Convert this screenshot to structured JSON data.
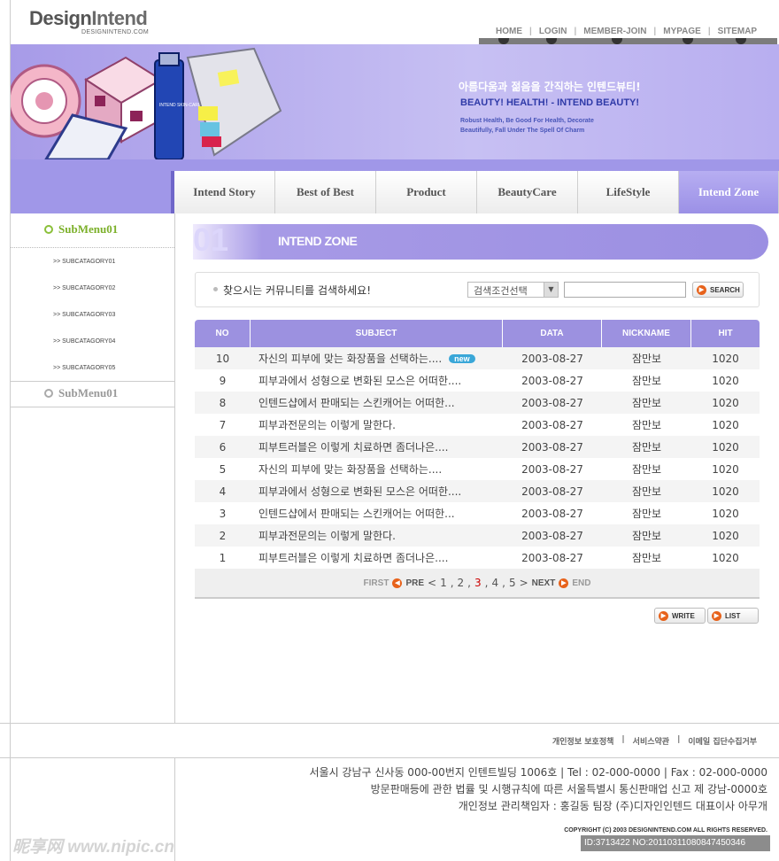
{
  "header": {
    "logo_main_a": "Design",
    "logo_main_b": "Intend",
    "logo_sub": "DESIGNINTEND.COM",
    "topnav": [
      "HOME",
      "LOGIN",
      "MEMBER-JOIN",
      "MYPAGE",
      "SITEMAP"
    ]
  },
  "banner": {
    "slogan_ko": "아름다움과 젊음을 간직하는 인텐드뷰티!",
    "slogan_en": "BEAUTY!  HEALTH! - INTEND BEAUTY!",
    "tagline_1": "Robust Health, Be Good For  Health, Decorate",
    "tagline_2": "Beautifully, Fall Under The Spell Of  Charm",
    "product_label": "INTEND SKIN-CARE"
  },
  "mainnav": [
    "Intend Story",
    "Best of Best",
    "Product",
    "BeautyCare",
    "LifeStyle",
    "Intend Zone"
  ],
  "sidebar": {
    "submenu_1": "SubMenu01",
    "submenu_2": "SubMenu01",
    "subcats": [
      ">> SUBCATAGORY01",
      ">> SUBCATAGORY02",
      ">> SUBCATAGORY03",
      ">> SUBCATAGORY04",
      ">> SUBCATAGORY05"
    ]
  },
  "content": {
    "title_num": "01",
    "title": "INTEND ZONE",
    "search_label": "찾으시는 커뮤니티를 검색하세요!",
    "search_select": "검색조건선택",
    "search_input": "",
    "search_button": "SEARCH"
  },
  "table": {
    "headers": [
      "NO",
      "SUBJECT",
      "DATA",
      "NICKNAME",
      "HIT"
    ],
    "new_badge": "new",
    "rows": [
      {
        "no": "10",
        "subject": "자신의 피부에 맞는 화장품을 선택하는....",
        "date": "2003-08-27",
        "nick": "잠만보",
        "hit": "1020"
      },
      {
        "no": "9",
        "subject": "피부과에서 성형으로 변화된 모스은 어떠한....",
        "date": "2003-08-27",
        "nick": "잠만보",
        "hit": "1020"
      },
      {
        "no": "8",
        "subject": "인텐드샵에서 판매되는 스킨캐어는 어떠한...",
        "date": "2003-08-27",
        "nick": "잠만보",
        "hit": "1020"
      },
      {
        "no": "7",
        "subject": "피부과전문의는 이렇게 말한다.",
        "date": "2003-08-27",
        "nick": "잠만보",
        "hit": "1020"
      },
      {
        "no": "6",
        "subject": "피부트러블은 이렇게 치료하면 좀더나은....",
        "date": "2003-08-27",
        "nick": "잠만보",
        "hit": "1020"
      },
      {
        "no": "5",
        "subject": "자신의 피부에 맞는 화장품을 선택하는....",
        "date": "2003-08-27",
        "nick": "잠만보",
        "hit": "1020"
      },
      {
        "no": "4",
        "subject": "피부과에서 성형으로 변화된 모스은 어떠한....",
        "date": "2003-08-27",
        "nick": "잠만보",
        "hit": "1020"
      },
      {
        "no": "3",
        "subject": "인텐드샵에서 판매되는 스킨캐어는 어떠한...",
        "date": "2003-08-27",
        "nick": "잠만보",
        "hit": "1020"
      },
      {
        "no": "2",
        "subject": "피부과전문의는 이렇게 말한다.",
        "date": "2003-08-27",
        "nick": "잠만보",
        "hit": "1020"
      },
      {
        "no": "1",
        "subject": "피부트러블은 이렇게 치료하면 좀더나은....",
        "date": "2003-08-27",
        "nick": "잠만보",
        "hit": "1020"
      }
    ]
  },
  "pager": {
    "first": "FIRST",
    "pre": "PRE",
    "lt": "<",
    "gt": ">",
    "pages": [
      "1",
      "2",
      "3",
      "4",
      "5"
    ],
    "current": "3",
    "next": "NEXT",
    "end": "END"
  },
  "actions": {
    "write": "WRITE",
    "list": "LIST"
  },
  "footer": {
    "links": [
      "개인정보 보호정책",
      "서비스약관",
      "이메일 집단수집거부"
    ],
    "addr_1": "서울시  강남구 신사동 000-00번지  인텐트빌딩 1006호     |  Tel : 02-000-0000 | Fax : 02-000-0000",
    "addr_2": "방문판매등에 관한 법률 및 시행규칙에 따른 서울특별시 통신판매업 신고 제 강남-0000호",
    "addr_3": "개인정보 관리책임자 : 홍길동 팀장 (주)디자인인텐드 대표이사 아무개",
    "copyright": "COPYRIGHT (C) 2003 DESIGNINTEND.COM ALL RIGHTS RESERVED.",
    "image_id": "ID:3713422 NO:20110311080847450346",
    "watermark": "昵享网 www.nipic.cn"
  },
  "colors": {
    "accent": "#9c91e0",
    "nav_active": "#a79be8",
    "green": "#7cb02a",
    "orange": "#e7621b",
    "new_badge": "#3aa7d8"
  }
}
